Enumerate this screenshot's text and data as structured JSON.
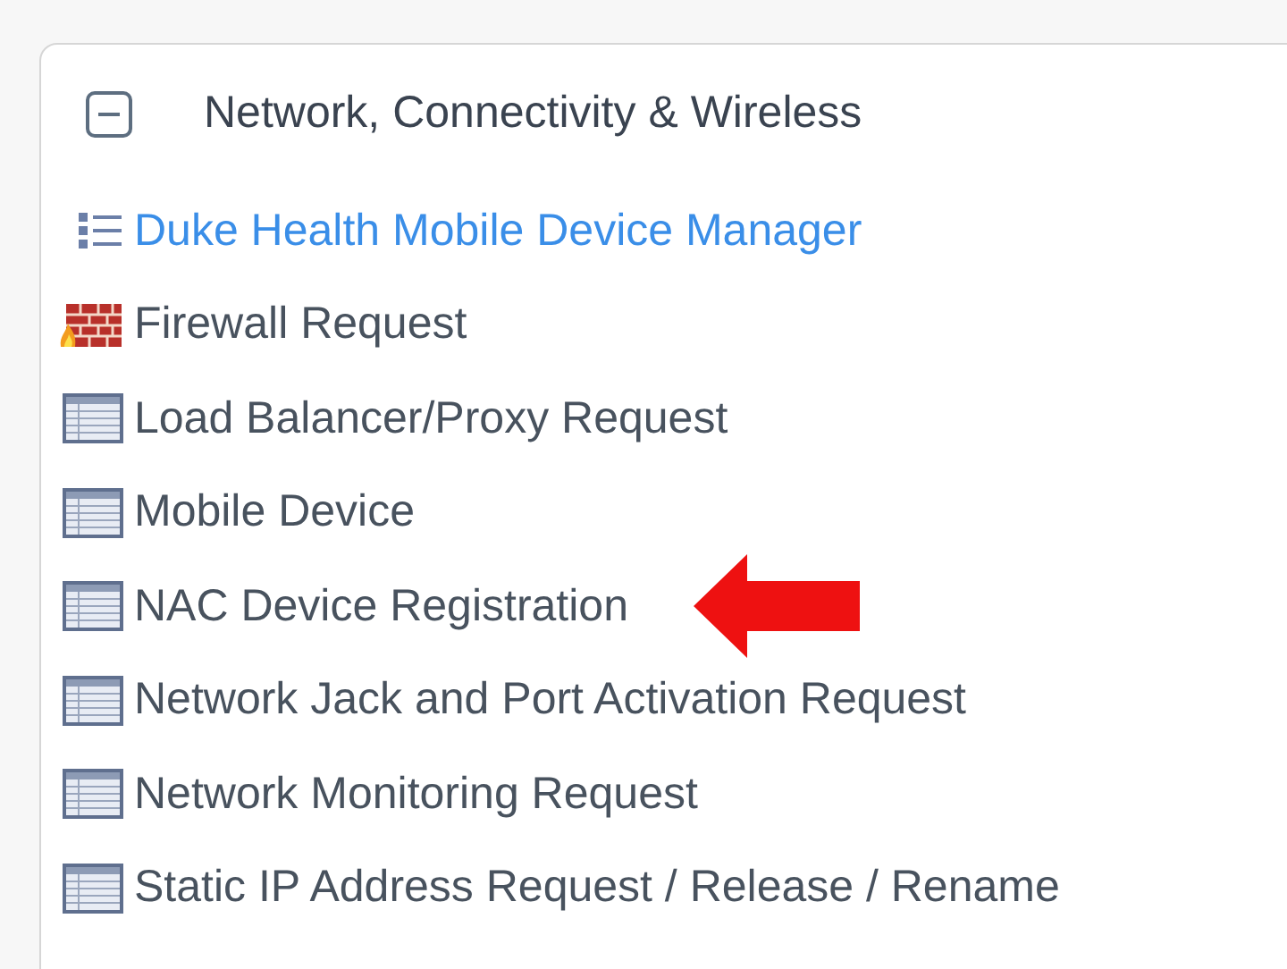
{
  "section": {
    "title": "Network, Connectivity & Wireless",
    "expanded": true,
    "items": [
      {
        "kind": "link",
        "label": "Duke Health Mobile Device Manager"
      },
      {
        "kind": "firewall",
        "label": "Firewall Request"
      },
      {
        "kind": "form",
        "label": "Load Balancer/Proxy Request"
      },
      {
        "kind": "form",
        "label": "Mobile Device"
      },
      {
        "kind": "form",
        "label": "NAC Device Registration",
        "pointer": true
      },
      {
        "kind": "form",
        "label": "Network Jack and Port Activation Request"
      },
      {
        "kind": "form",
        "label": "Network Monitoring Request"
      },
      {
        "kind": "form",
        "label": "Static IP Address Request / Release / Rename"
      }
    ]
  }
}
